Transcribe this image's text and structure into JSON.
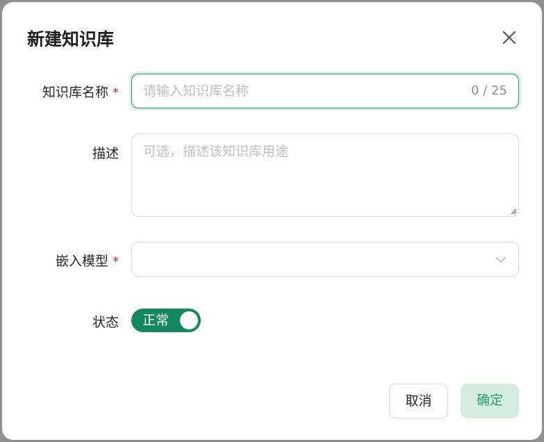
{
  "dialog": {
    "title": "新建知识库",
    "close_icon": "close-icon"
  },
  "form": {
    "name": {
      "label": "知识库名称",
      "required_mark": "*",
      "placeholder": "请输入知识库名称",
      "value": "",
      "counter": "0 / 25"
    },
    "description": {
      "label": "描述",
      "placeholder": "可选，描述该知识库用途",
      "value": ""
    },
    "embedding_model": {
      "label": "嵌入模型",
      "required_mark": "*",
      "value": "",
      "icon": "chevron-down-icon"
    },
    "status": {
      "label": "状态",
      "toggle_text": "正常",
      "enabled": true
    }
  },
  "footer": {
    "cancel_label": "取消",
    "confirm_label": "确定"
  },
  "colors": {
    "accent": "#13875f",
    "accent_light": "#d5ece3",
    "focus_border": "#2a9a72",
    "required": "#d4304a"
  }
}
